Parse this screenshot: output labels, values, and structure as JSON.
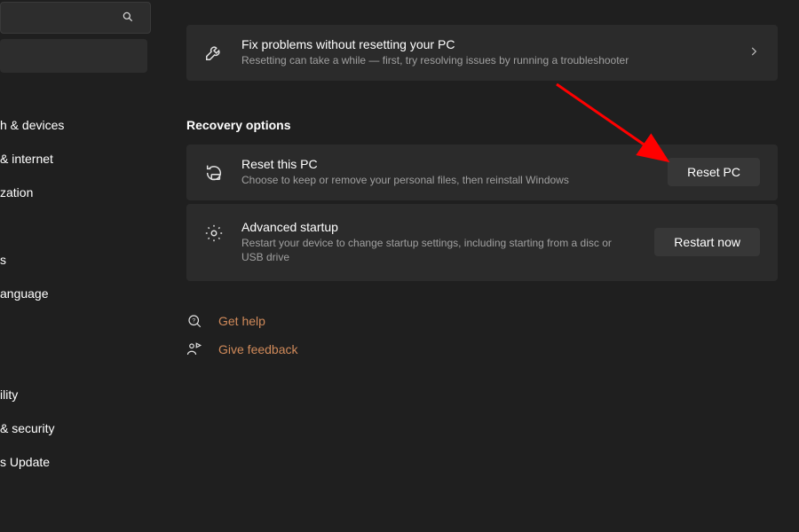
{
  "sidebar": {
    "items": [
      {
        "label": "h & devices"
      },
      {
        "label": "& internet"
      },
      {
        "label": "zation"
      },
      {
        "label": ""
      },
      {
        "label": "s"
      },
      {
        "label": "anguage"
      },
      {
        "label": ""
      },
      {
        "label": ""
      },
      {
        "label": "ility"
      },
      {
        "label": "& security"
      },
      {
        "label": "s Update"
      }
    ]
  },
  "fix": {
    "title": "Fix problems without resetting your PC",
    "sub": "Resetting can take a while — first, try resolving issues by running a troubleshooter"
  },
  "section_title": "Recovery options",
  "reset": {
    "title": "Reset this PC",
    "sub": "Choose to keep or remove your personal files, then reinstall Windows",
    "button": "Reset PC"
  },
  "advanced": {
    "title": "Advanced startup",
    "sub": "Restart your device to change startup settings, including starting from a disc or USB drive",
    "button": "Restart now"
  },
  "help": {
    "get_help": "Get help",
    "feedback": "Give feedback"
  }
}
